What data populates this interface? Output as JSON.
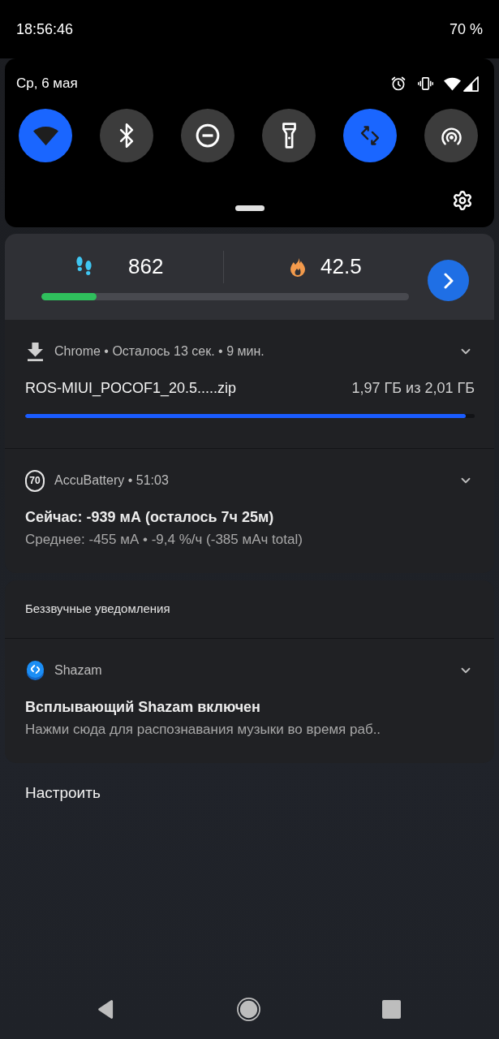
{
  "status_bar": {
    "time": "18:56:46",
    "battery": "70 %"
  },
  "quick_settings": {
    "date": "Ср, 6 мая",
    "tiles": [
      {
        "kind": "wifi",
        "on": true
      },
      {
        "kind": "bluetooth",
        "on": false
      },
      {
        "kind": "do_not_disturb",
        "on": false
      },
      {
        "kind": "flashlight",
        "on": false
      },
      {
        "kind": "auto_rotate",
        "on": true
      },
      {
        "kind": "hotspot",
        "on": false
      }
    ]
  },
  "fitness_widget": {
    "steps": "862",
    "calories": "42.5",
    "level": 0.15
  },
  "notifications": [
    {
      "kind": "download",
      "header": "Chrome • Осталось 13 сек. • 9 мин.",
      "expanded": false,
      "title": "ROS-MIUI_POCOF1_20.5.....zip",
      "size": "1,97 ГБ из 2,01 ГБ",
      "level": 0.98
    },
    {
      "kind": "battery",
      "badge": "70",
      "header": "AccuBattery • 51:03",
      "expanded": false,
      "title": "Сейчас: -939 мА (осталось 7ч 25м)",
      "text": "Среднее: -455 мА • -9,4 %/ч (-385 мАч total)"
    }
  ],
  "silent_section": {
    "title": "Беззвучные уведомления",
    "notifications": [
      {
        "kind": "app",
        "header": "Shazam",
        "expanded": false,
        "title": "Всплывающий Shazam включен",
        "text": "Нажми сюда для распознавания музыки во время раб.."
      }
    ]
  },
  "manage_button": "Настроить"
}
